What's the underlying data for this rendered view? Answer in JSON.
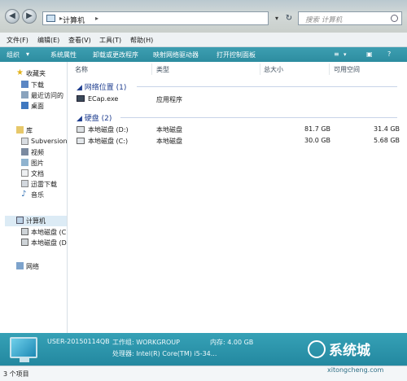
{
  "address": {
    "path": "计算机",
    "search_placeholder": "搜索 计算机"
  },
  "menu": [
    "文件(F)",
    "编辑(E)",
    "查看(V)",
    "工具(T)",
    "帮助(H)"
  ],
  "toolbar": {
    "organize": "组织",
    "items": [
      "系统属性",
      "卸载或更改程序",
      "映射网络驱动器",
      "打开控制面板"
    ]
  },
  "sidebar": {
    "favorites": {
      "label": "收藏夹",
      "items": [
        "下载",
        "最近访问的",
        "桌面"
      ]
    },
    "library": {
      "label": "库",
      "items": [
        "Subversion",
        "视频",
        "图片",
        "文档",
        "迅雷下载",
        "音乐"
      ]
    },
    "computer": {
      "label": "计算机",
      "items": [
        "本地磁盘 (C",
        "本地磁盘 (D"
      ]
    },
    "network": {
      "label": "网络"
    }
  },
  "columns": {
    "name": "名称",
    "type": "类型",
    "total": "总大小",
    "free": "可用空间"
  },
  "groups": {
    "network_location": {
      "header": "网络位置 (1)",
      "items": [
        {
          "name": "ECap.exe",
          "type": "应用程序"
        }
      ]
    },
    "hard_disks": {
      "header": "硬盘 (2)",
      "items": [
        {
          "name": "本地磁盘 (D:)",
          "type": "本地磁盘",
          "total": "81.7 GB",
          "free": "31.4 GB"
        },
        {
          "name": "本地磁盘 (C:)",
          "type": "本地磁盘",
          "total": "30.0 GB",
          "free": "5.68 GB"
        }
      ]
    }
  },
  "details": {
    "computer_name": "USER-20150114QB",
    "workgroup": "工作组: WORKGROUP",
    "memory": "内存: 4.00 GB",
    "processor": "处理器: Intel(R) Core(TM) i5-34..."
  },
  "status": "3 个项目",
  "watermark": {
    "brand": "系统城",
    "site": "xitongcheng.com"
  }
}
